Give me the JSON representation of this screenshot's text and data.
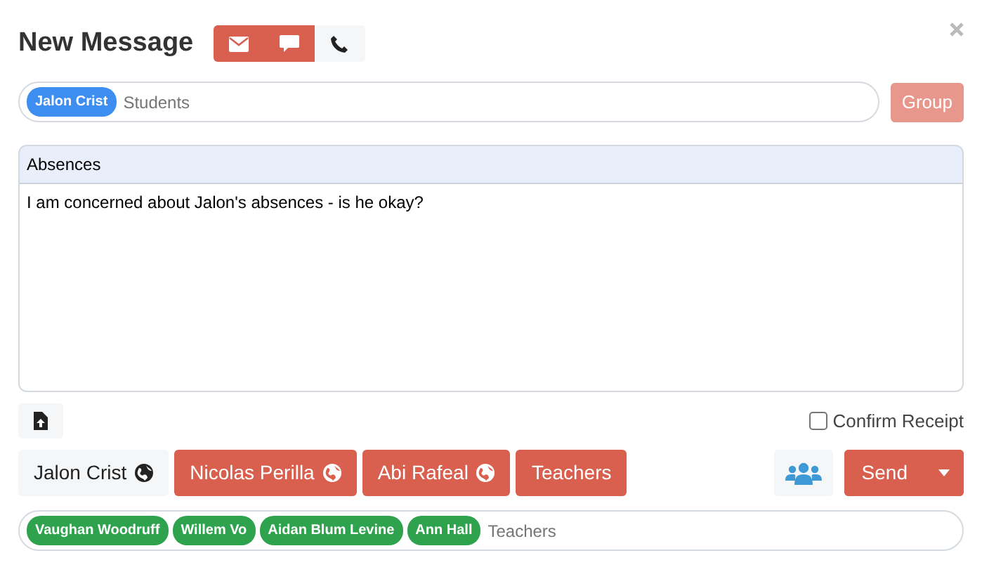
{
  "title": "New Message",
  "channels": [
    {
      "kind": "email",
      "selected": true
    },
    {
      "kind": "chat",
      "selected": true
    },
    {
      "kind": "phone",
      "selected": false
    }
  ],
  "to": {
    "tags": [
      "Jalon Crist"
    ],
    "placeholder": "Students"
  },
  "group_button": {
    "label": "Group",
    "disabled": true
  },
  "subject": "Absences",
  "body": "I am concerned about Jalon's absences - is he okay?",
  "confirm_receipt": {
    "label": "Confirm Receipt",
    "checked": false
  },
  "recipients": [
    {
      "label": "Jalon Crist",
      "kind": "person",
      "selected": false
    },
    {
      "label": "Nicolas Perilla",
      "kind": "person",
      "selected": true
    },
    {
      "label": "Abi Rafeal",
      "kind": "person",
      "selected": true
    },
    {
      "label": "Teachers",
      "kind": "group",
      "selected": true
    }
  ],
  "send_button": {
    "label": "Send"
  },
  "cc": {
    "tags": [
      "Vaughan Woodruff",
      "Willem Vo",
      "Aidan Blum Levine",
      "Ann Hall"
    ],
    "placeholder": "Teachers"
  }
}
